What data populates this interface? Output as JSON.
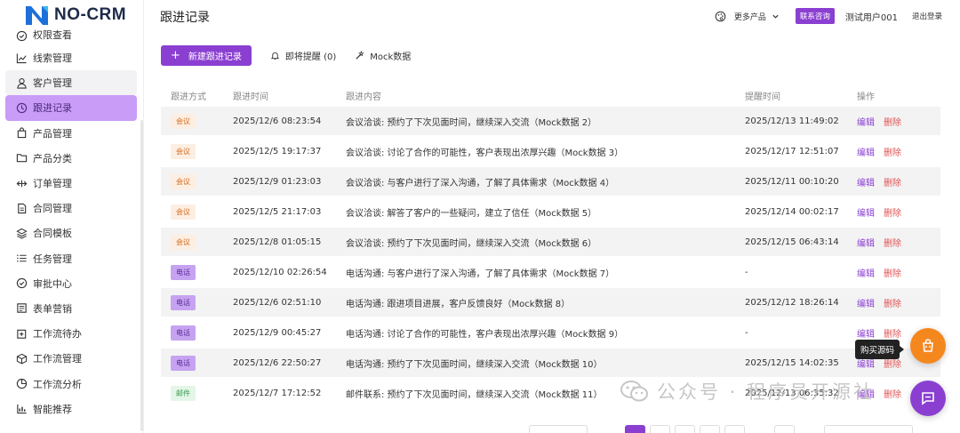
{
  "app": {
    "brand": "NO-CRM",
    "accent": "#8b3fd1"
  },
  "sidebar": {
    "items": [
      {
        "label": "权限查看",
        "icon": "shield-check-icon",
        "state": "partial"
      },
      {
        "label": "线索管理",
        "icon": "line-chart-icon",
        "state": ""
      },
      {
        "label": "客户管理",
        "icon": "user-icon",
        "state": "hover"
      },
      {
        "label": "跟进记录",
        "icon": "clock-icon",
        "state": "active"
      },
      {
        "label": "产品管理",
        "icon": "bag-icon",
        "state": ""
      },
      {
        "label": "产品分类",
        "icon": "folder-icon",
        "state": ""
      },
      {
        "label": "订单管理",
        "icon": "exchange-icon",
        "state": ""
      },
      {
        "label": "合同管理",
        "icon": "document-icon",
        "state": ""
      },
      {
        "label": "合同模板",
        "icon": "layers-icon",
        "state": ""
      },
      {
        "label": "任务管理",
        "icon": "list-icon",
        "state": ""
      },
      {
        "label": "审批中心",
        "icon": "check-circle-icon",
        "state": ""
      },
      {
        "label": "表单营销",
        "icon": "form-icon",
        "state": ""
      },
      {
        "label": "工作流待办",
        "icon": "todo-icon",
        "state": ""
      },
      {
        "label": "工作流管理",
        "icon": "cube-icon",
        "state": ""
      },
      {
        "label": "工作流分析",
        "icon": "pie-icon",
        "state": ""
      },
      {
        "label": "智能推荐",
        "icon": "bar-chart-icon",
        "state": ""
      }
    ]
  },
  "header": {
    "title": "跟进记录",
    "more_products": "更多产品",
    "contact": "联系咨询",
    "user": "测试用户001",
    "logout": "退出登录"
  },
  "toolbar": {
    "new_label": "新建跟进记录",
    "reminder_label": "即将提醒 (0)",
    "mock_label": "Mock数据"
  },
  "table": {
    "columns": [
      "跟进方式",
      "跟进时间",
      "跟进内容",
      "提醒时间",
      "操作"
    ],
    "edit_label": "编辑",
    "delete_label": "删除",
    "rows": [
      {
        "type": "会议",
        "kind": "meet",
        "time": "2025/12/6 08:23:54",
        "content": "会议洽谈: 预约了下次见面时间，继续深入交流（Mock数据 2）",
        "remind": "2025/12/13 11:49:02"
      },
      {
        "type": "会议",
        "kind": "meet",
        "time": "2025/12/5 19:17:37",
        "content": "会议洽谈: 讨论了合作的可能性，客户表现出浓厚兴趣（Mock数据 3）",
        "remind": "2025/12/17 12:51:07"
      },
      {
        "type": "会议",
        "kind": "meet",
        "time": "2025/12/9 01:23:03",
        "content": "会议洽谈: 与客户进行了深入沟通，了解了具体需求（Mock数据 4）",
        "remind": "2025/12/11 00:10:20"
      },
      {
        "type": "会议",
        "kind": "meet",
        "time": "2025/12/5 21:17:03",
        "content": "会议洽谈: 解答了客户的一些疑问，建立了信任（Mock数据 5）",
        "remind": "2025/12/14 00:02:17"
      },
      {
        "type": "会议",
        "kind": "meet",
        "time": "2025/12/8 01:05:15",
        "content": "会议洽谈: 预约了下次见面时间，继续深入交流（Mock数据 6）",
        "remind": "2025/12/15 06:43:14"
      },
      {
        "type": "电话",
        "kind": "call",
        "time": "2025/12/10 02:26:54",
        "content": "电话沟通: 与客户进行了深入沟通，了解了具体需求（Mock数据 7）",
        "remind": "-"
      },
      {
        "type": "电话",
        "kind": "call",
        "time": "2025/12/6 02:51:10",
        "content": "电话沟通: 跟进项目进展，客户反馈良好（Mock数据 8）",
        "remind": "2025/12/12 18:26:14"
      },
      {
        "type": "电话",
        "kind": "call",
        "time": "2025/12/9 00:45:27",
        "content": "电话沟通: 讨论了合作的可能性，客户表现出浓厚兴趣（Mock数据 9）",
        "remind": "-"
      },
      {
        "type": "电话",
        "kind": "call",
        "time": "2025/12/6 22:50:27",
        "content": "电话沟通: 预约了下次见面时间，继续深入交流（Mock数据 10）",
        "remind": "2025/12/15 14:02:35"
      },
      {
        "type": "邮件",
        "kind": "mail",
        "time": "2025/12/7 17:12:52",
        "content": "邮件联系: 预约了下次见面时间，继续深入交流（Mock数据 11）",
        "remind": "2025/12/13 06:35:32"
      }
    ]
  },
  "overlay": {
    "buy_source": "购买源码",
    "watermark": "公众号 · 程序员开源社"
  }
}
